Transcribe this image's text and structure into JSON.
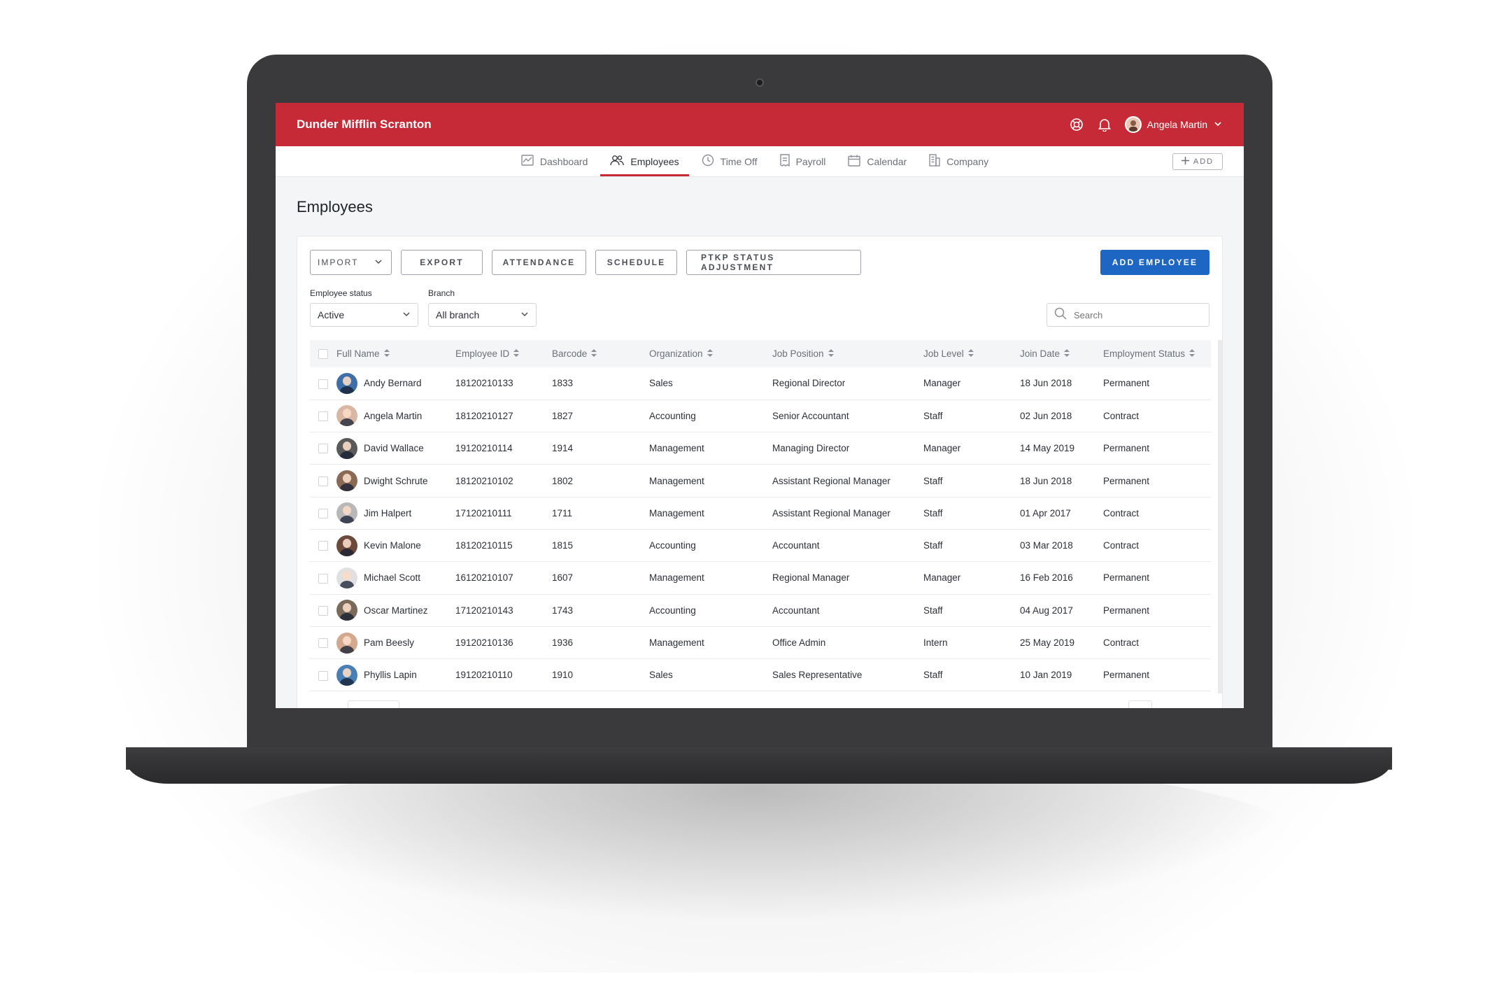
{
  "app": {
    "brand": "Dunder Mifflin Scranton",
    "user_name": "Angela Martin",
    "accent": "#c62a36",
    "primary": "#1e66c4"
  },
  "nav": {
    "items": [
      {
        "label": "Dashboard",
        "icon": "chart-icon"
      },
      {
        "label": "Employees",
        "icon": "users-icon"
      },
      {
        "label": "Time Off",
        "icon": "clock-icon"
      },
      {
        "label": "Payroll",
        "icon": "receipt-icon"
      },
      {
        "label": "Calendar",
        "icon": "calendar-icon"
      },
      {
        "label": "Company",
        "icon": "building-icon"
      }
    ],
    "active": "Employees",
    "add_label": "ADD"
  },
  "page": {
    "title": "Employees"
  },
  "toolbar": {
    "import_label": "IMPORT",
    "export_label": "EXPORT",
    "attendance_label": "ATTENDANCE",
    "schedule_label": "SCHEDULE",
    "ptkp_label": "PTKP STATUS ADJUSTMENT",
    "add_employee_label": "ADD EMPLOYEE"
  },
  "filters": {
    "status_label": "Employee status",
    "status_value": "Active",
    "branch_label": "Branch",
    "branch_value": "All branch",
    "search_placeholder": "Search"
  },
  "table": {
    "columns": [
      "Full Name",
      "Employee ID",
      "Barcode",
      "Organization",
      "Job Position",
      "Job Level",
      "Join Date",
      "Employment Status"
    ],
    "rows": [
      {
        "name": "Andy Bernard",
        "id": "18120210133",
        "barcode": "1833",
        "org": "Sales",
        "position": "Regional Director",
        "level": "Manager",
        "join": "18 Jun 2018",
        "status": "Permanent",
        "avatar_color": "#3f6fa8"
      },
      {
        "name": "Angela Martin",
        "id": "18120210127",
        "barcode": "1827",
        "org": "Accounting",
        "position": "Senior Accountant",
        "level": "Staff",
        "join": "02 Jun 2018",
        "status": "Contract",
        "avatar_color": "#d9b7a4"
      },
      {
        "name": "David Wallace",
        "id": "19120210114",
        "barcode": "1914",
        "org": "Management",
        "position": "Managing Director",
        "level": "Manager",
        "join": "14 May 2019",
        "status": "Permanent",
        "avatar_color": "#5a5a5a"
      },
      {
        "name": "Dwight Schrute",
        "id": "18120210102",
        "barcode": "1802",
        "org": "Management",
        "position": "Assistant Regional Manager",
        "level": "Staff",
        "join": "18 Jun 2018",
        "status": "Permanent",
        "avatar_color": "#8a6a55"
      },
      {
        "name": "Jim Halpert",
        "id": "17120210111",
        "barcode": "1711",
        "org": "Management",
        "position": "Assistant Regional Manager",
        "level": "Staff",
        "join": "01 Apr 2017",
        "status": "Contract",
        "avatar_color": "#b8b8b8"
      },
      {
        "name": "Kevin Malone",
        "id": "18120210115",
        "barcode": "1815",
        "org": "Accounting",
        "position": "Accountant",
        "level": "Staff",
        "join": "03 Mar 2018",
        "status": "Contract",
        "avatar_color": "#6d4b3c"
      },
      {
        "name": "Michael Scott",
        "id": "16120210107",
        "barcode": "1607",
        "org": "Management",
        "position": "Regional Manager",
        "level": "Manager",
        "join": "16 Feb 2016",
        "status": "Permanent",
        "avatar_color": "#e0e0e0"
      },
      {
        "name": "Oscar Martinez",
        "id": "17120210143",
        "barcode": "1743",
        "org": "Accounting",
        "position": "Accountant",
        "level": "Staff",
        "join": "04 Aug 2017",
        "status": "Permanent",
        "avatar_color": "#7a6a5a"
      },
      {
        "name": "Pam Beesly",
        "id": "19120210136",
        "barcode": "1936",
        "org": "Management",
        "position": "Office Admin",
        "level": "Intern",
        "join": "25 May 2019",
        "status": "Contract",
        "avatar_color": "#d4a88e"
      },
      {
        "name": "Phyllis Lapin",
        "id": "19120210110",
        "barcode": "1910",
        "org": "Sales",
        "position": "Sales Representative",
        "level": "Staff",
        "join": "10 Jan 2019",
        "status": "Permanent",
        "avatar_color": "#4a7fb5"
      }
    ]
  }
}
